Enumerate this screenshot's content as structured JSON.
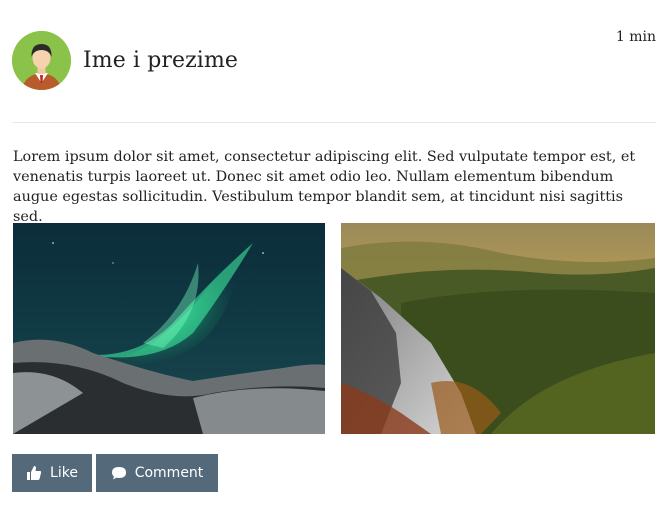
{
  "post": {
    "author": "Ime i prezime",
    "time": "1 min",
    "text": "Lorem ipsum dolor sit amet, consectetur adipiscing elit. Sed vulputate tempor est, et venenatis turpis laoreet ut. Donec sit amet odio leo. Nullam elementum bibendum augue egestas sollicitudin. Vestibulum tempor blandit sem, at tincidunt nisi sagittis sed.",
    "images": [
      {
        "subject": "aurora borealis over snowy mountains"
      },
      {
        "subject": "misty forested mountains with waterfall"
      }
    ]
  },
  "actions": {
    "like_label": "Like",
    "comment_label": "Comment",
    "like_icon": "thumbs-up-icon",
    "comment_icon": "speech-bubble-icon"
  },
  "colors": {
    "button_bg": "#546a7b",
    "avatar_bg": "#8bc34a",
    "divider": "#e8e8e8"
  }
}
